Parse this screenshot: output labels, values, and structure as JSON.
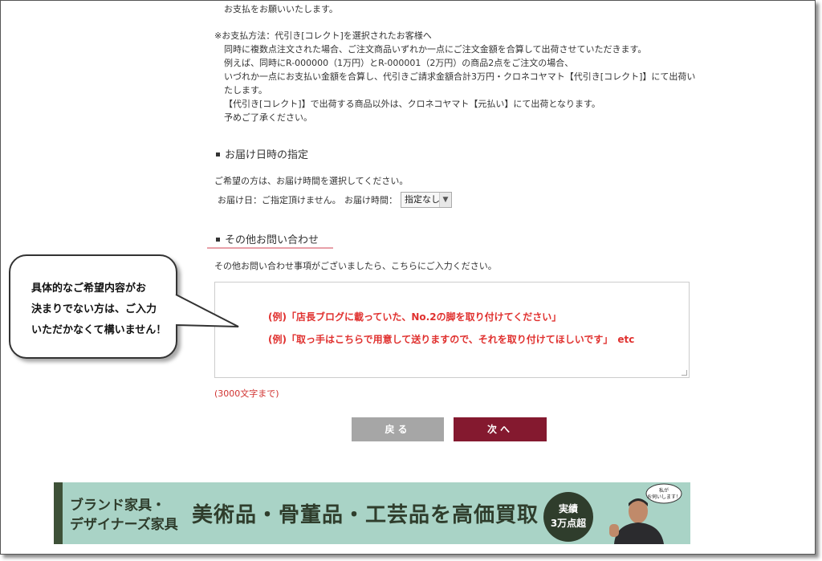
{
  "payment_notes": {
    "line0": "お支払をお願いいたします。",
    "line1": "※お支払方法：代引き[コレクト]を選択されたお客様へ",
    "line2": "同時に複数点注文された場合、ご注文商品いずれか一点にご注文金額を合算して出荷させていただきます。",
    "line3": "例えば、同時にR-000000（1万円）とR-000001（2万円）の商品2点をご注文の場合、",
    "line4": "いづれか一点にお支払い金額を合算し、代引きご請求金額合計3万円・クロネコヤマト【代引き[コレクト]】にて出荷い",
    "line5": "たします。",
    "line6": "【代引き[コレクト]】で出荷する商品以外は、クロネコヤマト【元払い】にて出荷となります。",
    "line7": "予めご了承ください。"
  },
  "delivery": {
    "title": "お届け日時の指定",
    "desc": "ご希望の方は、お届け時間を選択してください。",
    "date_label": "お届け日：ご指定頂けません。",
    "time_label": "お届け時間：",
    "time_value": "指定なし"
  },
  "inquiry": {
    "title": "その他お問い合わせ",
    "desc": "その他お問い合わせ事項がございましたら、こちらにご入力ください。",
    "example1": "(例)「店長ブログに載っていた、No.2の脚を取り付けてください」",
    "example2": "(例)「取っ手はこちらで用意して送りますので、それを取り付けてほしいです」　etc",
    "limit": "(3000文字まで)"
  },
  "buttons": {
    "back": "戻る",
    "next": "次へ"
  },
  "bubble": {
    "line1": "具体的なご希望内容がお",
    "line2": "決まりでない方は、ご入力",
    "line3": "いただかなくて構いません！"
  },
  "banner": {
    "sub1": "ブランド家具・",
    "sub2": "デザイナーズ家具",
    "main": "美術品・骨董品・工芸品を高価買取",
    "badge1": "実績",
    "badge2": "3万点超",
    "speech1": "私が",
    "speech2": "お伺いします！"
  },
  "colors": {
    "accent": "#84192f",
    "example_text": "#e0312f",
    "banner_bg": "#a9d3c6",
    "banner_dark": "#2f3d2c"
  }
}
